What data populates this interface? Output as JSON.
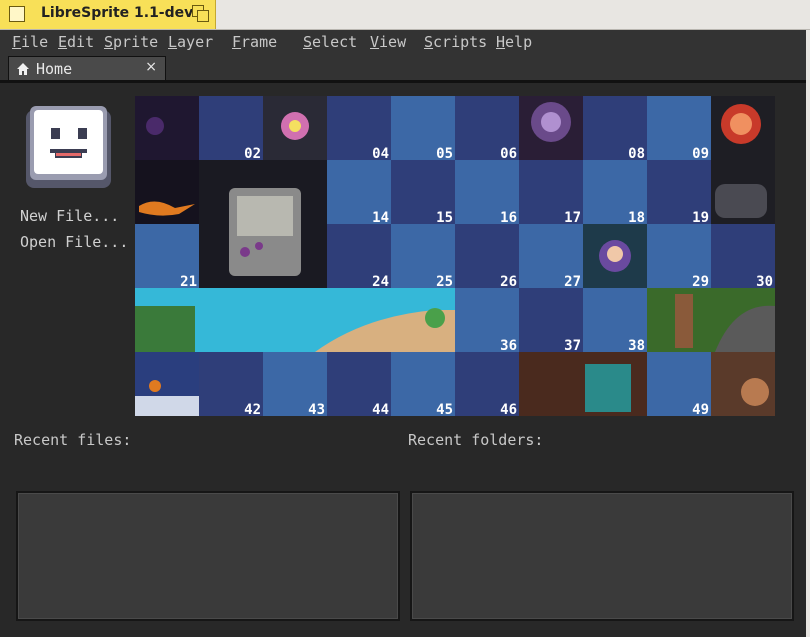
{
  "window": {
    "title": "LibreSprite 1.1-dev"
  },
  "menu": [
    {
      "label": "File"
    },
    {
      "label": "Edit"
    },
    {
      "label": "Sprite"
    },
    {
      "label": "Layer"
    },
    {
      "label": "Frame"
    },
    {
      "label": "Select"
    },
    {
      "label": "View"
    },
    {
      "label": "Scripts"
    },
    {
      "label": "Help"
    }
  ],
  "tabs": [
    {
      "label": "Home",
      "icon": "home-icon",
      "close": "×"
    }
  ],
  "home": {
    "new_file": "New File...",
    "open_file": "Open File...",
    "recent_files": "Recent files:",
    "recent_folders": "Recent folders:",
    "tile_numbers": [
      "02",
      "04",
      "05",
      "06",
      "08",
      "09",
      "14",
      "15",
      "16",
      "17",
      "18",
      "19",
      "21",
      "24",
      "25",
      "26",
      "27",
      "29",
      "30",
      "36",
      "37",
      "38",
      "42",
      "43",
      "44",
      "45",
      "46",
      "49"
    ]
  },
  "colors": {
    "tile_dark": "#2f3e79",
    "tile_light": "#3c68a6",
    "panel": "#3a3a3a",
    "titlebar_accent": "#f8e058"
  }
}
